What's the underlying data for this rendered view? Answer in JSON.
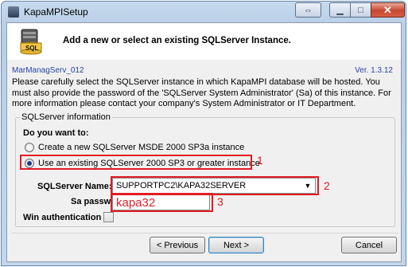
{
  "window": {
    "title": "KapaMPISetup",
    "controls": {
      "restore": "⇔",
      "minimize": "▁",
      "maximize": "□",
      "close": "✕"
    }
  },
  "header": {
    "title": "Add a new or select an existing SQLServer Instance.",
    "icon": "sql-server-icon",
    "icon_text": "SQL"
  },
  "meta": {
    "sublabel": "MarManagServ_012",
    "version": "Ver. 1.3.12"
  },
  "intro": "Please carefully select the SQLServer instance in which KapaMPI database will be hosted. You must also provide the password of the 'SQLServer System Administrator' (Sa) of this instance. For more information please contact your company's System Administrator or IT Department.",
  "group": {
    "title": "SQLServer information",
    "question": "Do you want to:",
    "options": [
      {
        "label": "Create a new SQLServer MSDE 2000 SP3a instance",
        "selected": false
      },
      {
        "label": "Use an existing SQLServer 2000 SP3 or greater instance",
        "selected": true
      }
    ],
    "server_name_label": "SQLServer Name:",
    "server_name_value": "SUPPORTPC2\\KAPA32SERVER",
    "sa_password_label": "Sa password:",
    "sa_password_value": "kapa32",
    "win_auth_label": "Win authentication",
    "win_auth_checked": false
  },
  "annotations": {
    "color": "#e31c24",
    "markers": [
      "1",
      "2",
      "3"
    ]
  },
  "buttons": {
    "previous": "< Previous",
    "next": "Next >",
    "cancel": "Cancel"
  }
}
